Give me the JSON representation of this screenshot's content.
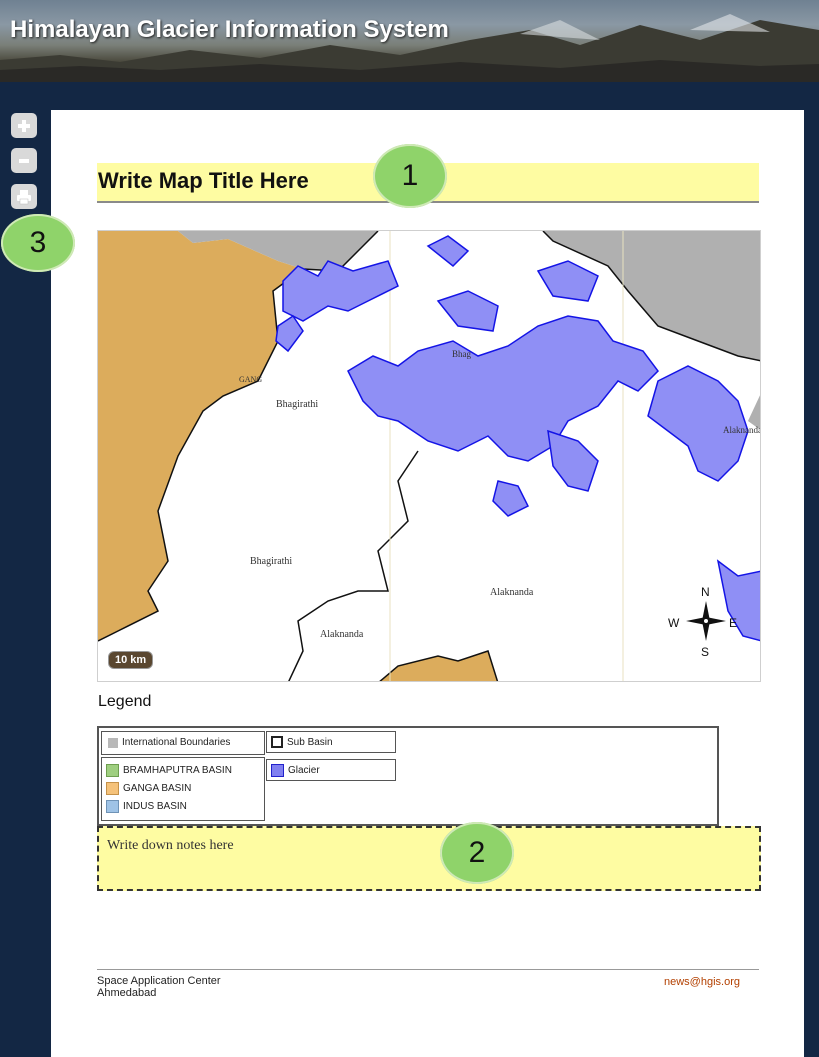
{
  "header": {
    "title": "Himalayan Glacier Information System"
  },
  "toolbar": {
    "zoom_in_icon": "plus-icon",
    "zoom_out_icon": "minus-icon",
    "print_icon": "print-icon"
  },
  "callouts": [
    "1",
    "2",
    "3"
  ],
  "map_title": {
    "text": "Write Map Title Here"
  },
  "map": {
    "scale_bar": "10 km",
    "labels": [
      "Bhagirathi",
      "Bhagirathi",
      "Alaknanda",
      "Alaknanda",
      "GANG",
      "Bhag",
      "Alaknanda"
    ],
    "compass": {
      "n": "N",
      "s": "S",
      "w": "W",
      "e": "E"
    },
    "colors": {
      "ganga_basin": "#dcac5c",
      "boundary_gray": "#b0b0b0",
      "glacier_fill": "#8f8ff5",
      "glacier_stroke": "#1414e6"
    }
  },
  "legend": {
    "title": "Legend",
    "items": {
      "international_boundaries": "International Boundaries",
      "sub_basin": "Sub Basin",
      "glacier": "Glacier",
      "brahmaputra": "BRAMHAPUTRA BASIN",
      "ganga": "GANGA BASIN",
      "indus": "INDUS BASIN"
    },
    "colors": {
      "international_boundaries": "#b8b8b8",
      "brahmaputra": "#9fcf80",
      "ganga": "#f5c27a",
      "indus": "#9fc3e6",
      "glacier": "#8080f0"
    }
  },
  "notes": {
    "placeholder": "Write down notes here"
  },
  "footer": {
    "org_line1": "Space Application Center",
    "org_line2": "Ahmedabad",
    "email": "news@hgis.org"
  }
}
